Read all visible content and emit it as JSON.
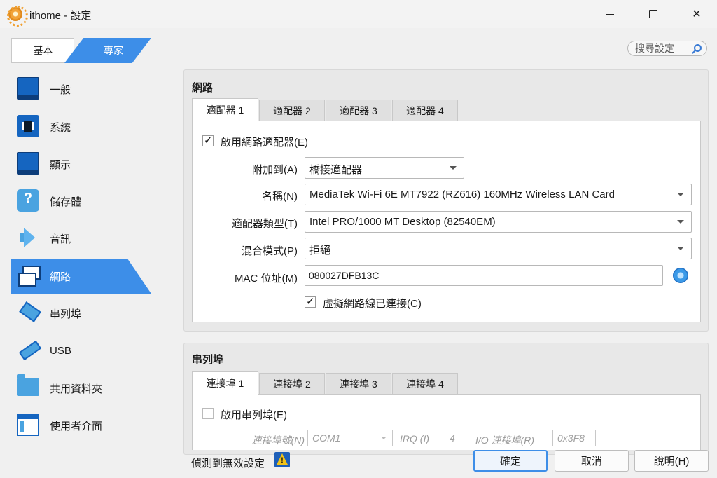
{
  "window": {
    "title": "ithome - 設定"
  },
  "mode": {
    "basic": "基本",
    "expert": "專家"
  },
  "search": {
    "placeholder": "搜尋設定"
  },
  "sidebar": {
    "items": [
      {
        "label": "一般",
        "icon": "monitor-icon"
      },
      {
        "label": "系統",
        "icon": "chip-icon"
      },
      {
        "label": "顯示",
        "icon": "display-icon"
      },
      {
        "label": "儲存體",
        "icon": "disk-icon"
      },
      {
        "label": "音訊",
        "icon": "speaker-icon"
      },
      {
        "label": "網路",
        "icon": "network-icon",
        "active": true
      },
      {
        "label": "串列埠",
        "icon": "serial-icon"
      },
      {
        "label": "USB",
        "icon": "usb-icon"
      },
      {
        "label": "共用資料夾",
        "icon": "folder-icon"
      },
      {
        "label": "使用者介面",
        "icon": "ui-icon"
      }
    ]
  },
  "network": {
    "title": "網路",
    "tabs": [
      "適配器 1",
      "適配器 2",
      "適配器 3",
      "適配器 4"
    ],
    "enable_label": "啟用網路適配器(E)",
    "enable_checked": true,
    "attached_label": "附加到(A)",
    "attached_value": "橋接適配器",
    "name_label": "名稱(N)",
    "name_value": "MediaTek Wi-Fi 6E MT7922 (RZ616) 160MHz Wireless LAN Card",
    "adapter_type_label": "適配器類型(T)",
    "adapter_type_value": "Intel PRO/1000 MT Desktop (82540EM)",
    "promisc_label": "混合模式(P)",
    "promisc_value": "拒絕",
    "mac_label": "MAC 位址(M)",
    "mac_value": "080027DFB13C",
    "cable_label": "虛擬網路線已連接(C)",
    "cable_checked": true
  },
  "serial": {
    "title": "串列埠",
    "tabs": [
      "連接埠 1",
      "連接埠 2",
      "連接埠 3",
      "連接埠 4"
    ],
    "enable_label": "啟用串列埠(E)",
    "enable_checked": false,
    "port_number_label": "連接埠號(N)",
    "port_number_value": "COM1",
    "irq_label": "IRQ (I)",
    "irq_value": "4",
    "io_label": "I/O 連接埠(R)",
    "io_value": "0x3F8"
  },
  "footer": {
    "status": "偵測到無效設定",
    "ok": "確定",
    "cancel": "取消",
    "help": "說明(H)"
  },
  "colors": {
    "accent": "#3d8ee8"
  }
}
